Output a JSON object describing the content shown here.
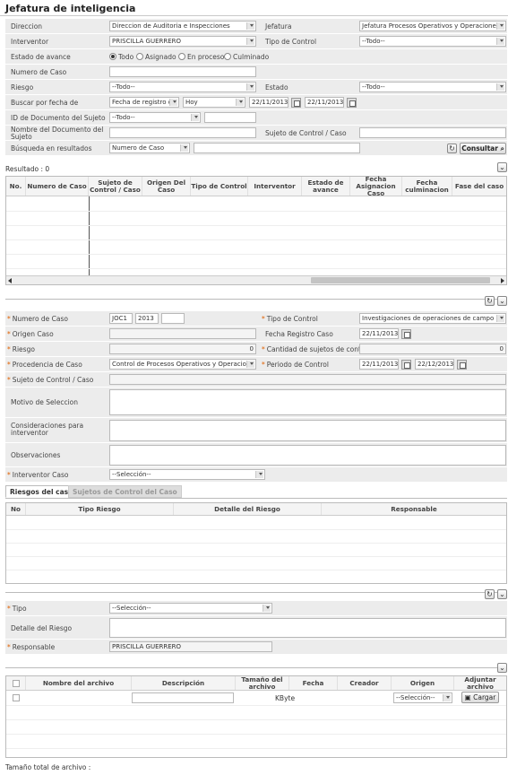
{
  "page": {
    "title": "Jefatura de inteligencia"
  },
  "search": {
    "direccion_label": "Direccion",
    "direccion_value": "Direccion de Auditoria e Inspecciones",
    "jefatura_label": "Jefatura",
    "jefatura_value": "Jefatura Procesos Operativos y Operaciones c",
    "interventor_label": "Interventor",
    "interventor_value": "PRISCILLA GUERRERO",
    "tipo_control_label": "Tipo de Control",
    "tipo_control_value": "--Todo--",
    "estado_avance_label": "Estado de avance",
    "radio_todo": "Todo",
    "radio_asignado": "Asignado",
    "radio_proceso": "En proceso",
    "radio_culminado": "Culminado",
    "numero_caso_label": "Numero de Caso",
    "riesgo_label": "Riesgo",
    "riesgo_value": "--Todo--",
    "estado_label": "Estado",
    "estado_value": "--Todo--",
    "buscar_fecha_label": "Buscar por fecha de",
    "buscar_fecha_value": "Fecha de registro d",
    "hoy_value": "Hoy",
    "fecha_desde": "22/11/2013",
    "fecha_hasta": "22/11/2013",
    "id_doc_label": "ID de Documento del Sujeto",
    "id_doc_value": "--Todo--",
    "nombre_doc_label": "Nombre del Documento del Sujeto",
    "sujeto_control_label": "Sujeto de Control / Caso",
    "busqueda_label": "Búsqueda en resultados",
    "busqueda_value": "Numero de Caso",
    "consultar_label": "Consultar"
  },
  "results": {
    "count_label": "Resultado : 0",
    "columns": [
      "No.",
      "Numero de Caso",
      "Sujeto de Control / Caso",
      "Origen Del Caso",
      "Tipo de Control",
      "Interventor",
      "Estado de avance",
      "Fecha Asignacion Caso",
      "Fecha culminacion",
      "Fase del caso"
    ]
  },
  "caso": {
    "numero_label": "Numero de Caso",
    "numero_prefix": "JOC1",
    "numero_year": "2013",
    "tipo_control_label": "Tipo de Control",
    "tipo_control_value": "Investigaciones de operaciones de campo",
    "origen_label": "Origen Caso",
    "fecha_registro_label": "Fecha Registro Caso",
    "fecha_registro_value": "22/11/2013",
    "riesgo_label": "Riesgo",
    "riesgo_value": "0",
    "cantidad_label": "Cantidad de sujetos de control",
    "cantidad_value": "0",
    "procedencia_label": "Procedencia de Caso",
    "procedencia_value": "Control de Procesos Operativos y Operacione",
    "periodo_label": "Periodo de Control",
    "periodo_desde": "22/11/2013",
    "periodo_hasta": "22/12/2013",
    "sujeto_label": "Sujeto de Control / Caso",
    "motivo_label": "Motivo de Seleccion",
    "consideraciones_label": "Consideraciones para interventor",
    "observaciones_label": "Observaciones",
    "interventor_label": "Interventor Caso",
    "interventor_value": "--Selección--"
  },
  "tabs": [
    "Riesgos del caso",
    "Sujetos de Control del Caso"
  ],
  "riesgos_table": {
    "columns": [
      "No",
      "Tipo Riesgo",
      "Detalle del Riesgo",
      "Responsable"
    ]
  },
  "riesgo_form": {
    "tipo_label": "Tipo",
    "tipo_value": "--Selección--",
    "detalle_label": "Detalle del Riesgo",
    "responsable_label": "Responsable",
    "responsable_value": "PRISCILLA GUERRERO"
  },
  "archivos": {
    "columns": [
      "Nombre del archivo",
      "Descripción",
      "Tamaño del archivo",
      "Fecha",
      "Creador",
      "Origen",
      "Adjuntar archivo"
    ],
    "kbyte": "KByte",
    "origen_value": "--Selección--",
    "cargar_label": "Cargar",
    "total_label": "Tamaño total de archivo :"
  }
}
